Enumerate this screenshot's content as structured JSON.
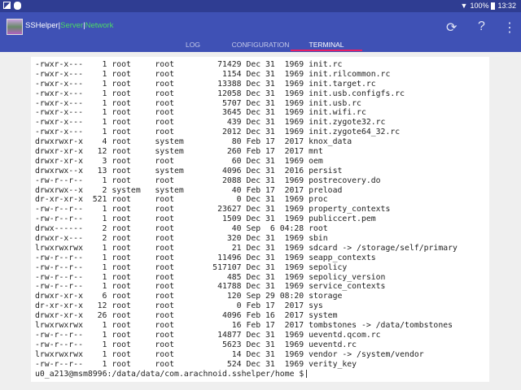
{
  "status_bar": {
    "battery": "100%",
    "time": "13:32"
  },
  "app": {
    "name": "SSHelper",
    "sep": "|",
    "server": "Server",
    "network": "Network"
  },
  "actions": {
    "refresh": "refresh-icon",
    "help": "?",
    "menu": "more-vert-icon"
  },
  "tabs": [
    {
      "label": "LOG"
    },
    {
      "label": "CONFIGURATION"
    },
    {
      "label": "TERMINAL",
      "active": true
    }
  ],
  "colors": {
    "status_bar": "#2f3d92",
    "app_bar": "#3f51b5",
    "tab_indicator": "#e91e63",
    "status_green": "#4cd964"
  },
  "terminal": {
    "rows": [
      [
        "-rwxr-x---",
        "1",
        "root",
        "root",
        "71429",
        "Dec",
        "31",
        "1969",
        "init.rc"
      ],
      [
        "-rwxr-x---",
        "1",
        "root",
        "root",
        "1154",
        "Dec",
        "31",
        "1969",
        "init.rilcommon.rc"
      ],
      [
        "-rwxr-x---",
        "1",
        "root",
        "root",
        "13388",
        "Dec",
        "31",
        "1969",
        "init.target.rc"
      ],
      [
        "-rwxr-x---",
        "1",
        "root",
        "root",
        "12058",
        "Dec",
        "31",
        "1969",
        "init.usb.configfs.rc"
      ],
      [
        "-rwxr-x---",
        "1",
        "root",
        "root",
        "5707",
        "Dec",
        "31",
        "1969",
        "init.usb.rc"
      ],
      [
        "-rwxr-x---",
        "1",
        "root",
        "root",
        "3645",
        "Dec",
        "31",
        "1969",
        "init.wifi.rc"
      ],
      [
        "-rwxr-x---",
        "1",
        "root",
        "root",
        "439",
        "Dec",
        "31",
        "1969",
        "init.zygote32.rc"
      ],
      [
        "-rwxr-x---",
        "1",
        "root",
        "root",
        "2012",
        "Dec",
        "31",
        "1969",
        "init.zygote64_32.rc"
      ],
      [
        "drwxrwxr-x",
        "4",
        "root",
        "system",
        "80",
        "Feb",
        "17",
        "2017",
        "knox_data"
      ],
      [
        "drwxr-xr-x",
        "12",
        "root",
        "system",
        "260",
        "Feb",
        "17",
        "2017",
        "mnt"
      ],
      [
        "drwxr-xr-x",
        "3",
        "root",
        "root",
        "60",
        "Dec",
        "31",
        "1969",
        "oem"
      ],
      [
        "drwxrwx--x",
        "13",
        "root",
        "system",
        "4096",
        "Dec",
        "31",
        "2016",
        "persist"
      ],
      [
        "-rw-r--r--",
        "1",
        "root",
        "root",
        "2088",
        "Dec",
        "31",
        "1969",
        "postrecovery.do"
      ],
      [
        "drwxrwx--x",
        "2",
        "system",
        "system",
        "40",
        "Feb",
        "17",
        "2017",
        "preload"
      ],
      [
        "dr-xr-xr-x",
        "521",
        "root",
        "root",
        "0",
        "Dec",
        "31",
        "1969",
        "proc"
      ],
      [
        "-rw-r--r--",
        "1",
        "root",
        "root",
        "23627",
        "Dec",
        "31",
        "1969",
        "property_contexts"
      ],
      [
        "-rw-r--r--",
        "1",
        "root",
        "root",
        "1509",
        "Dec",
        "31",
        "1969",
        "publiccert.pem"
      ],
      [
        "drwx------",
        "2",
        "root",
        "root",
        "40",
        "Sep",
        "6",
        "04:28",
        "root"
      ],
      [
        "drwxr-x---",
        "2",
        "root",
        "root",
        "320",
        "Dec",
        "31",
        "1969",
        "sbin"
      ],
      [
        "lrwxrwxrwx",
        "1",
        "root",
        "root",
        "21",
        "Dec",
        "31",
        "1969",
        "sdcard -> /storage/self/primary"
      ],
      [
        "-rw-r--r--",
        "1",
        "root",
        "root",
        "11496",
        "Dec",
        "31",
        "1969",
        "seapp_contexts"
      ],
      [
        "-rw-r--r--",
        "1",
        "root",
        "root",
        "517107",
        "Dec",
        "31",
        "1969",
        "sepolicy"
      ],
      [
        "-rw-r--r--",
        "1",
        "root",
        "root",
        "485",
        "Dec",
        "31",
        "1969",
        "sepolicy_version"
      ],
      [
        "-rw-r--r--",
        "1",
        "root",
        "root",
        "41788",
        "Dec",
        "31",
        "1969",
        "service_contexts"
      ],
      [
        "drwxr-xr-x",
        "6",
        "root",
        "root",
        "120",
        "Sep",
        "29",
        "08:20",
        "storage"
      ],
      [
        "dr-xr-xr-x",
        "12",
        "root",
        "root",
        "0",
        "Feb",
        "17",
        "2017",
        "sys"
      ],
      [
        "drwxr-xr-x",
        "26",
        "root",
        "root",
        "4096",
        "Feb",
        "16",
        "2017",
        "system"
      ],
      [
        "lrwxrwxrwx",
        "1",
        "root",
        "root",
        "16",
        "Feb",
        "17",
        "2017",
        "tombstones -> /data/tombstones"
      ],
      [
        "-rw-r--r--",
        "1",
        "root",
        "root",
        "14877",
        "Dec",
        "31",
        "1969",
        "ueventd.qcom.rc"
      ],
      [
        "-rw-r--r--",
        "1",
        "root",
        "root",
        "5623",
        "Dec",
        "31",
        "1969",
        "ueventd.rc"
      ],
      [
        "lrwxrwxrwx",
        "1",
        "root",
        "root",
        "14",
        "Dec",
        "31",
        "1969",
        "vendor -> /system/vendor"
      ],
      [
        "-rw-r--r--",
        "1",
        "root",
        "root",
        "524",
        "Dec",
        "31",
        "1969",
        "verity_key"
      ]
    ],
    "prompt": "u0_a213@msm8996:/data/data/com.arachnoid.sshelper/home $"
  }
}
